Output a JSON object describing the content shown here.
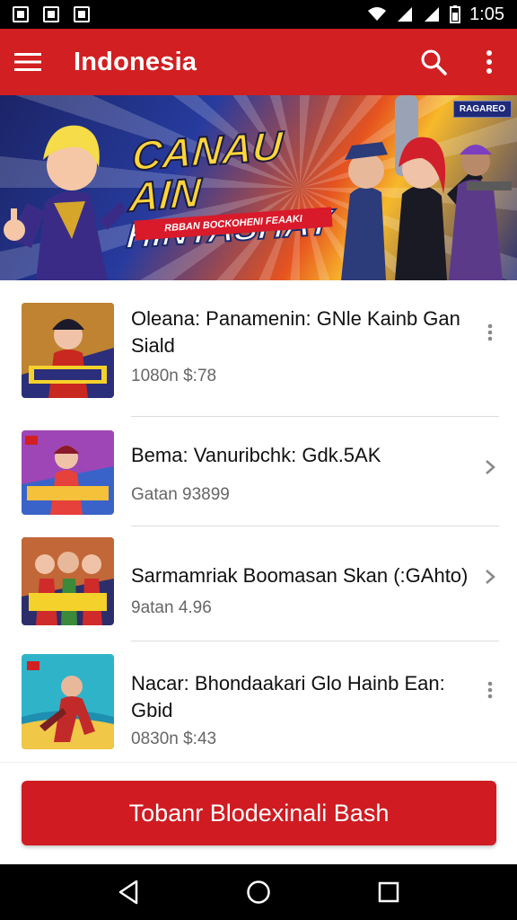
{
  "status_bar": {
    "time": "1:05"
  },
  "app_bar": {
    "title": "Indonesia",
    "menu_icon": "hamburger-menu-icon",
    "search_icon": "search-icon",
    "overflow_icon": "more-vert-icon"
  },
  "banner": {
    "title_line1": "CANAU AIN",
    "title_line2": "HINTASHAY",
    "ribbon": "RBBAN BOCKOHENI FEAAKI",
    "tag": "RAGAREO"
  },
  "list": {
    "items": [
      {
        "title": "Oleana: Panamenin: GNle Kainb Gan Siald",
        "meta": "1080n $:78",
        "trailing_icon": "more-vert-icon",
        "thumb_colors": [
          "#f2a01b",
          "#2b2e7a",
          "#c8281f"
        ]
      },
      {
        "title": "Bema: Vanuribchk: Gdk.5AK",
        "meta": "Gatan 93899",
        "trailing_icon": "chevron-right-icon",
        "thumb_colors": [
          "#b83fb0",
          "#3a63c9",
          "#e6413a"
        ]
      },
      {
        "title": "Sarmamriak Boomasan Skan (:GAhto)",
        "meta": "9atan 4.96",
        "trailing_icon": "chevron-right-icon",
        "thumb_colors": [
          "#e8762a",
          "#2c2e6c",
          "#cf2b2b"
        ]
      },
      {
        "title": "Nacar: Bhondaakari Glo Hainb Ean: Gbid",
        "meta": "0830n $:43",
        "trailing_icon": "more-vert-icon",
        "thumb_colors": [
          "#2fb3c9",
          "#c22a2a",
          "#f1c748"
        ]
      }
    ]
  },
  "cta": {
    "label": "Tobanr Blodexinali Bash"
  },
  "nav": {
    "back_icon": "back-icon",
    "home_icon": "home-icon",
    "recents_icon": "recents-icon"
  }
}
